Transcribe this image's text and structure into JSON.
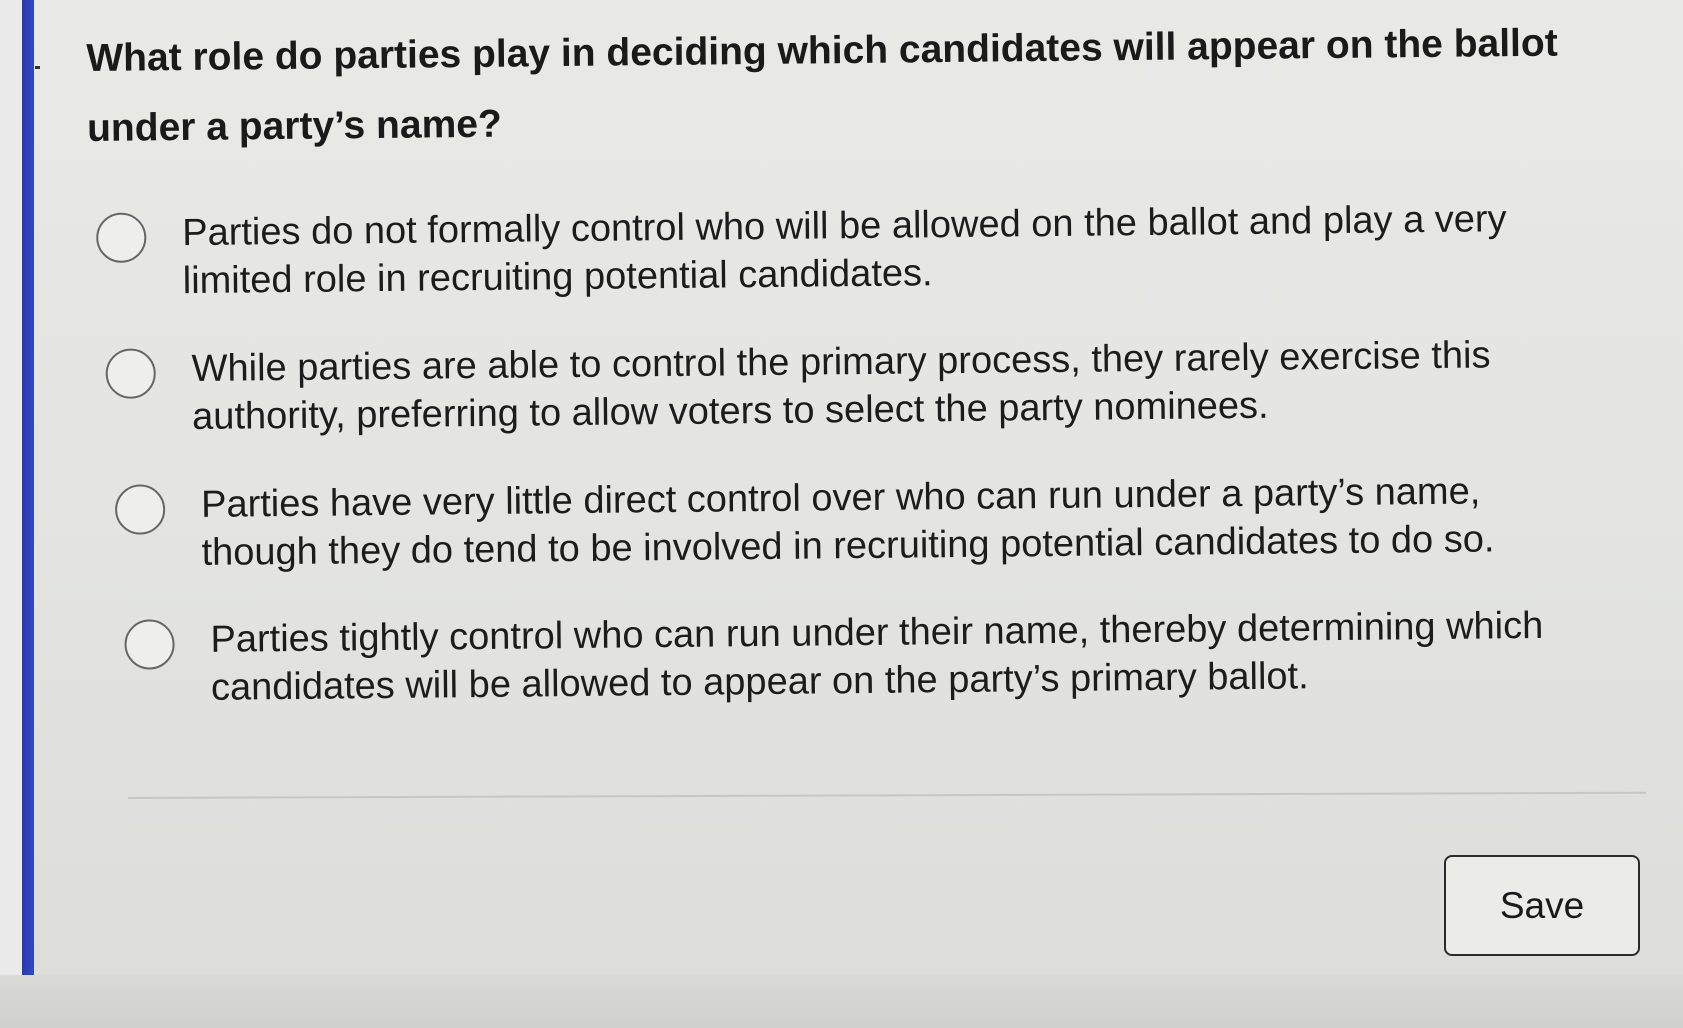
{
  "question": {
    "text": "What role do parties play in deciding which candidates will appear on the ballot under a party’s name?"
  },
  "options": [
    {
      "label": "Parties do not formally control who will be allowed on the ballot and play a very limited role in recruiting potential candidates.",
      "selected": false
    },
    {
      "label": "While parties are able to control the primary process, they rarely exercise this authority, preferring to allow voters to select the party nominees.",
      "selected": false
    },
    {
      "label": "Parties have very little direct control over who can run under a party’s name, though they do tend to be involved in recruiting potential candidates to do so.",
      "selected": false
    },
    {
      "label": "Parties tightly control who can run under their name, thereby determining which candidates will be allowed to appear on the party’s primary ballot.",
      "selected": false
    }
  ],
  "actions": {
    "save_label": "Save"
  },
  "colors": {
    "accent_bar": "#3446c2",
    "background": "#e5e5e2",
    "text": "#1c1c1c"
  }
}
